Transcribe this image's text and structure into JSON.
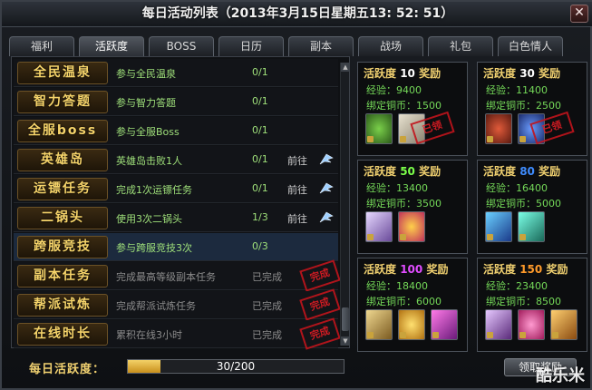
{
  "window": {
    "title": "每日活动列表（2013年3月15日星期五13: 52: 51）",
    "close_label": "✕"
  },
  "tabs": [
    {
      "label": "福利",
      "active": false
    },
    {
      "label": "活跃度",
      "active": true
    },
    {
      "label": "BOSS",
      "active": false
    },
    {
      "label": "日历",
      "active": false
    },
    {
      "label": "副本",
      "active": false
    },
    {
      "label": "战场",
      "active": false
    },
    {
      "label": "礼包",
      "active": false
    },
    {
      "label": "白色情人",
      "active": false
    }
  ],
  "activities": [
    {
      "name": "全民温泉",
      "desc": "参与全民温泉",
      "count": "0/1",
      "goto": "",
      "done_stamp": ""
    },
    {
      "name": "智力答题",
      "desc": "参与智力答题",
      "count": "0/1",
      "goto": "",
      "done_stamp": ""
    },
    {
      "name": "全服boss",
      "desc": "参与全服Boss",
      "count": "0/1",
      "goto": "",
      "done_stamp": ""
    },
    {
      "name": "英雄岛",
      "desc": "英雄岛击败1人",
      "count": "0/1",
      "goto": "前往",
      "done_stamp": ""
    },
    {
      "name": "运镖任务",
      "desc": "完成1次运镖任务",
      "count": "0/1",
      "goto": "前往",
      "done_stamp": ""
    },
    {
      "name": "二锅头",
      "desc": "使用3次二锅头",
      "count": "1/3",
      "goto": "前往",
      "done_stamp": ""
    },
    {
      "name": "跨服竞技",
      "desc": "参与跨服竞技3次",
      "count": "0/3",
      "goto": "",
      "done_stamp": ""
    },
    {
      "name": "副本任务",
      "desc": "完成最高等级副本任务",
      "count": "已完成",
      "goto": "",
      "done_stamp": "完成"
    },
    {
      "name": "帮派试炼",
      "desc": "完成帮派试炼任务",
      "count": "已完成",
      "goto": "",
      "done_stamp": "完成"
    },
    {
      "name": "在线时长",
      "desc": "累积在线3小时",
      "count": "已完成",
      "goto": "",
      "done_stamp": "完成"
    }
  ],
  "rewards": [
    {
      "label": "活跃度",
      "level": "10",
      "suffix": "奖励",
      "exp_label": "经验：",
      "exp": "9400",
      "coin_label": "绑定铜币：",
      "coin": "1500",
      "stamp": "已领"
    },
    {
      "label": "活跃度",
      "level": "30",
      "suffix": "奖励",
      "exp_label": "经验：",
      "exp": "11400",
      "coin_label": "绑定铜币：",
      "coin": "2500",
      "stamp": "已领"
    },
    {
      "label": "活跃度",
      "level": "50",
      "suffix": "奖励",
      "exp_label": "经验：",
      "exp": "13400",
      "coin_label": "绑定铜币：",
      "coin": "3500",
      "stamp": ""
    },
    {
      "label": "活跃度",
      "level": "80",
      "suffix": "奖励",
      "exp_label": "经验：",
      "exp": "16400",
      "coin_label": "绑定铜币：",
      "coin": "5000",
      "stamp": ""
    },
    {
      "label": "活跃度",
      "level": "100",
      "suffix": "奖励",
      "exp_label": "经验：",
      "exp": "18400",
      "coin_label": "绑定铜币：",
      "coin": "6000",
      "stamp": ""
    },
    {
      "label": "活跃度",
      "level": "150",
      "suffix": "奖励",
      "exp_label": "经验：",
      "exp": "23400",
      "coin_label": "绑定铜币：",
      "coin": "8500",
      "stamp": ""
    }
  ],
  "progress": {
    "label": "每日活跃度：",
    "current": 30,
    "max": 200,
    "text": "30/200",
    "fraction": 0.15
  },
  "claim_button": "领取奖励",
  "watermark": "酷乐米",
  "colors": {
    "gold": "#f0d070",
    "green_text": "#9fe07a",
    "done_text": "#8c8c8c",
    "stamp_red": "#e01c24",
    "highlight_row": "#1c2a3e"
  }
}
